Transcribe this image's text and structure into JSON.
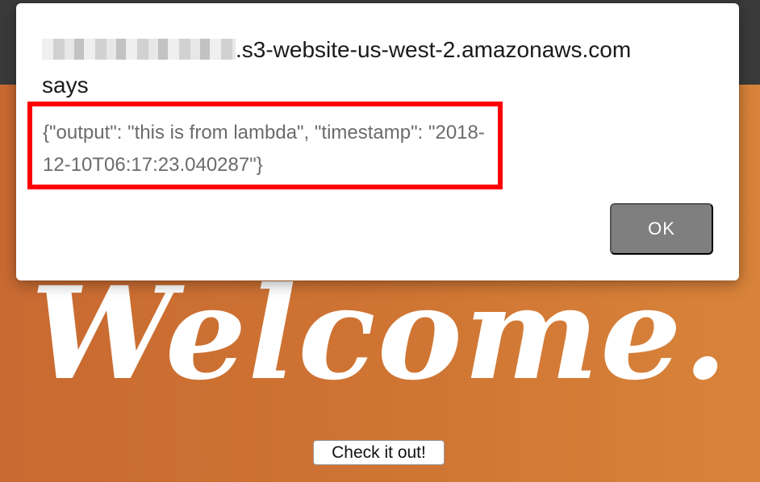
{
  "dialog": {
    "origin_domain": ".s3-website-us-west-2.amazonaws.com",
    "says": "says",
    "message": "{\"output\": \"this is from lambda\", \"timestamp\": \"2018-12-10T06:17:23.040287\"}",
    "ok_label": "OK"
  },
  "page": {
    "hero_title": "Welcome.",
    "cta_label": "Check it out!"
  },
  "colors": {
    "highlight": "#ff0000",
    "hero_background": "#cf7434",
    "header_background": "#3a3a3a",
    "ok_button": "#7f7f7f"
  }
}
